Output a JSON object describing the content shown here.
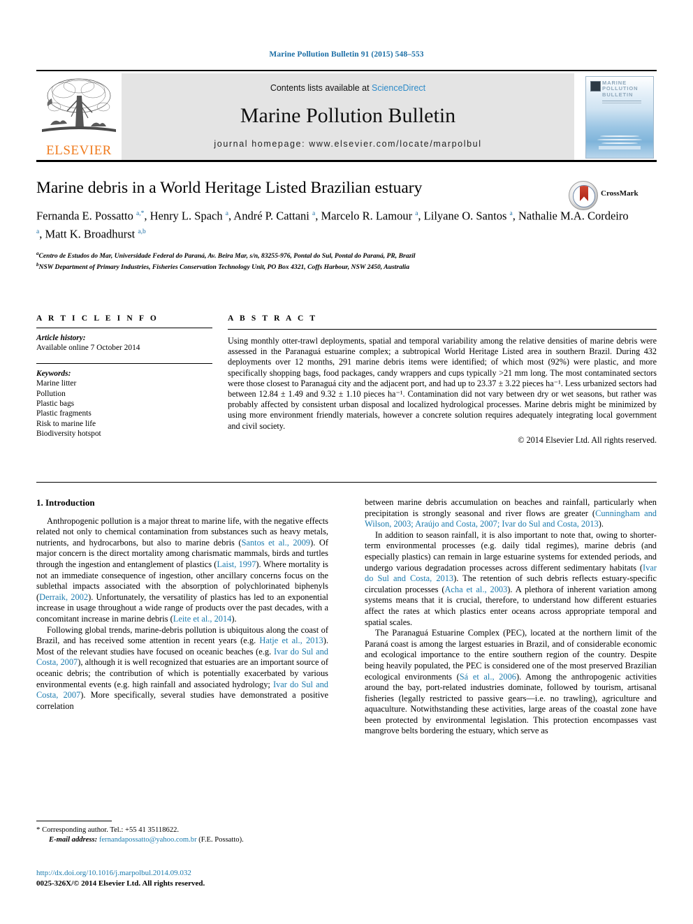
{
  "running_head": "Marine Pollution Bulletin 91 (2015) 548–553",
  "masthead": {
    "contents_prefix": "Contents lists available at ",
    "sciencedirect": "ScienceDirect",
    "journal_title": "Marine Pollution Bulletin",
    "homepage": "journal homepage: www.elsevier.com/locate/marpolbul",
    "publisher_name": "ELSEVIER",
    "cover_title_line1": "MARINE",
    "cover_title_line2": "POLLUTION",
    "cover_title_line3": "BULLETIN"
  },
  "crossmark": {
    "label": "CrossMark"
  },
  "article": {
    "title": "Marine debris in a World Heritage Listed Brazilian estuary",
    "authors_html": "Fernanda E. Possatto <sup>a,*</sup>, Henry L. Spach <sup>a</sup>, André P. Cattani <sup>a</sup>, Marcelo R. Lamour <sup>a</sup>, Lilyane O. Santos <sup>a</sup>, Nathalie M.A. Cordeiro <sup>a</sup>, Matt K. Broadhurst <sup>a,b</sup>",
    "affiliation_a": "Centro de Estudos do Mar, Universidade Federal do Paraná, Av. Beira Mar, s/n, 83255-976, Pontal do Sul, Pontal do Paraná, PR, Brazil",
    "affiliation_b": "NSW Department of Primary Industries, Fisheries Conservation Technology Unit, PO Box 4321, Coffs Harbour, NSW 2450, Australia"
  },
  "article_info": {
    "heading": "A R T I C L E   I N F O",
    "history_label": "Article history:",
    "history_value": "Available online 7 October 2014",
    "keywords_label": "Keywords:",
    "keywords": [
      "Marine litter",
      "Pollution",
      "Plastic bags",
      "Plastic fragments",
      "Risk to marine life",
      "Biodiversity hotspot"
    ]
  },
  "abstract": {
    "heading": "A B S T R A C T",
    "body": "Using monthly otter-trawl deployments, spatial and temporal variability among the relative densities of marine debris were assessed in the Paranaguá estuarine complex; a subtropical World Heritage Listed area in southern Brazil. During 432 deployments over 12 months, 291 marine debris items were identified; of which most (92%) were plastic, and more specifically shopping bags, food packages, candy wrappers and cups typically >21 mm long. The most contaminated sectors were those closest to Paranaguá city and the adjacent port, and had up to 23.37 ± 3.22 pieces ha⁻¹. Less urbanized sectors had between 12.84 ± 1.49 and 9.32 ± 1.10 pieces ha⁻¹. Contamination did not vary between dry or wet seasons, but rather was probably affected by consistent urban disposal and localized hydrological processes. Marine debris might be minimized by using more environment friendly materials, however a concrete solution requires adequately integrating local government and civil society.",
    "copyright": "© 2014 Elsevier Ltd. All rights reserved."
  },
  "introduction": {
    "section_title": "1. Introduction",
    "left_paragraphs_html": [
      "Anthropogenic pollution is a major threat to marine life, with the negative effects related not only to chemical contamination from substances such as heavy metals, nutrients, and hydrocarbons, but also to marine debris (<span class=\"ref\">Santos et al., 2009</span>). Of major concern is the direct mortality among charismatic mammals, birds and turtles through the ingestion and entanglement of plastics (<span class=\"ref\">Laist, 1997</span>). Where mortality is not an immediate consequence of ingestion, other ancillary concerns focus on the sublethal impacts associated with the absorption of polychlorinated biphenyls (<span class=\"ref\">Derraik, 2002</span>). Unfortunately, the versatility of plastics has led to an exponential increase in usage throughout a wide range of products over the past decades, with a concomitant increase in marine debris (<span class=\"ref\">Leite et al., 2014</span>).",
      "Following global trends, marine-debris pollution is ubiquitous along the coast of Brazil, and has received some attention in recent years (e.g. <span class=\"ref\">Hatje et al., 2013</span>). Most of the relevant studies have focused on oceanic beaches (e.g. <span class=\"ref\">Ivar do Sul and Costa, 2007</span>), although it is well recognized that estuaries are an important source of oceanic debris; the contribution of which is potentially exacerbated by various environmental events (e.g. high rainfall and associated hydrology; <span class=\"ref\">Ivar do Sul and Costa, 2007</span>). More specifically, several studies have demonstrated a positive correlation"
    ],
    "right_paragraphs_html": [
      "between marine debris accumulation on beaches and rainfall, particularly when precipitation is strongly seasonal and river flows are greater (<span class=\"ref\">Cunningham and Wilson, 2003; Araújo and Costa, 2007; Ivar do Sul and Costa, 2013</span>).",
      "In addition to season rainfall, it is also important to note that, owing to shorter-term environmental processes (e.g. daily tidal regimes), marine debris (and especially plastics) can remain in large estuarine systems for extended periods, and undergo various degradation processes across different sedimentary habitats (<span class=\"ref\">Ivar do Sul and Costa, 2013</span>). The retention of such debris reflects estuary-specific circulation processes (<span class=\"ref\">Acha et al., 2003</span>). A plethora of inherent variation among systems means that it is crucial, therefore, to understand how different estuaries affect the rates at which plastics enter oceans across appropriate temporal and spatial scales.",
      "The Paranaguá Estuarine Complex (PEC), located at the northern limit of the Paraná coast is among the largest estuaries in Brazil, and of considerable economic and ecological importance to the entire southern region of the country. Despite being heavily populated, the PEC is considered one of the most preserved Brazilian ecological environments (<span class=\"ref\">Sá et al., 2006</span>). Among the anthropogenic activities around the bay, port-related industries dominate, followed by tourism, artisanal fisheries (legally restricted to passive gears—i.e. no trawling), agriculture and aquaculture. Notwithstanding these activities, large areas of the coastal zone have been protected by environmental legislation. This protection encompasses vast mangrove belts bordering the estuary, which serve as"
    ]
  },
  "footnote": {
    "corresponding_star": "*",
    "corresponding_text": "Corresponding author. Tel.: +55 41 35118622.",
    "email_label": "E-mail address:",
    "email_address": "fernandapossatto@yahoo.com.br",
    "email_owner": "(F.E. Possatto)."
  },
  "imprint": {
    "doi": "http://dx.doi.org/10.1016/j.marpolbul.2014.09.032",
    "issn_line": "0025-326X/© 2014 Elsevier Ltd. All rights reserved."
  },
  "colors": {
    "link_blue": "#1b7aad",
    "running_head_blue": "#1b6ea5",
    "elsevier_orange": "#f07c1f",
    "band_gray": "#e4e4e4"
  }
}
